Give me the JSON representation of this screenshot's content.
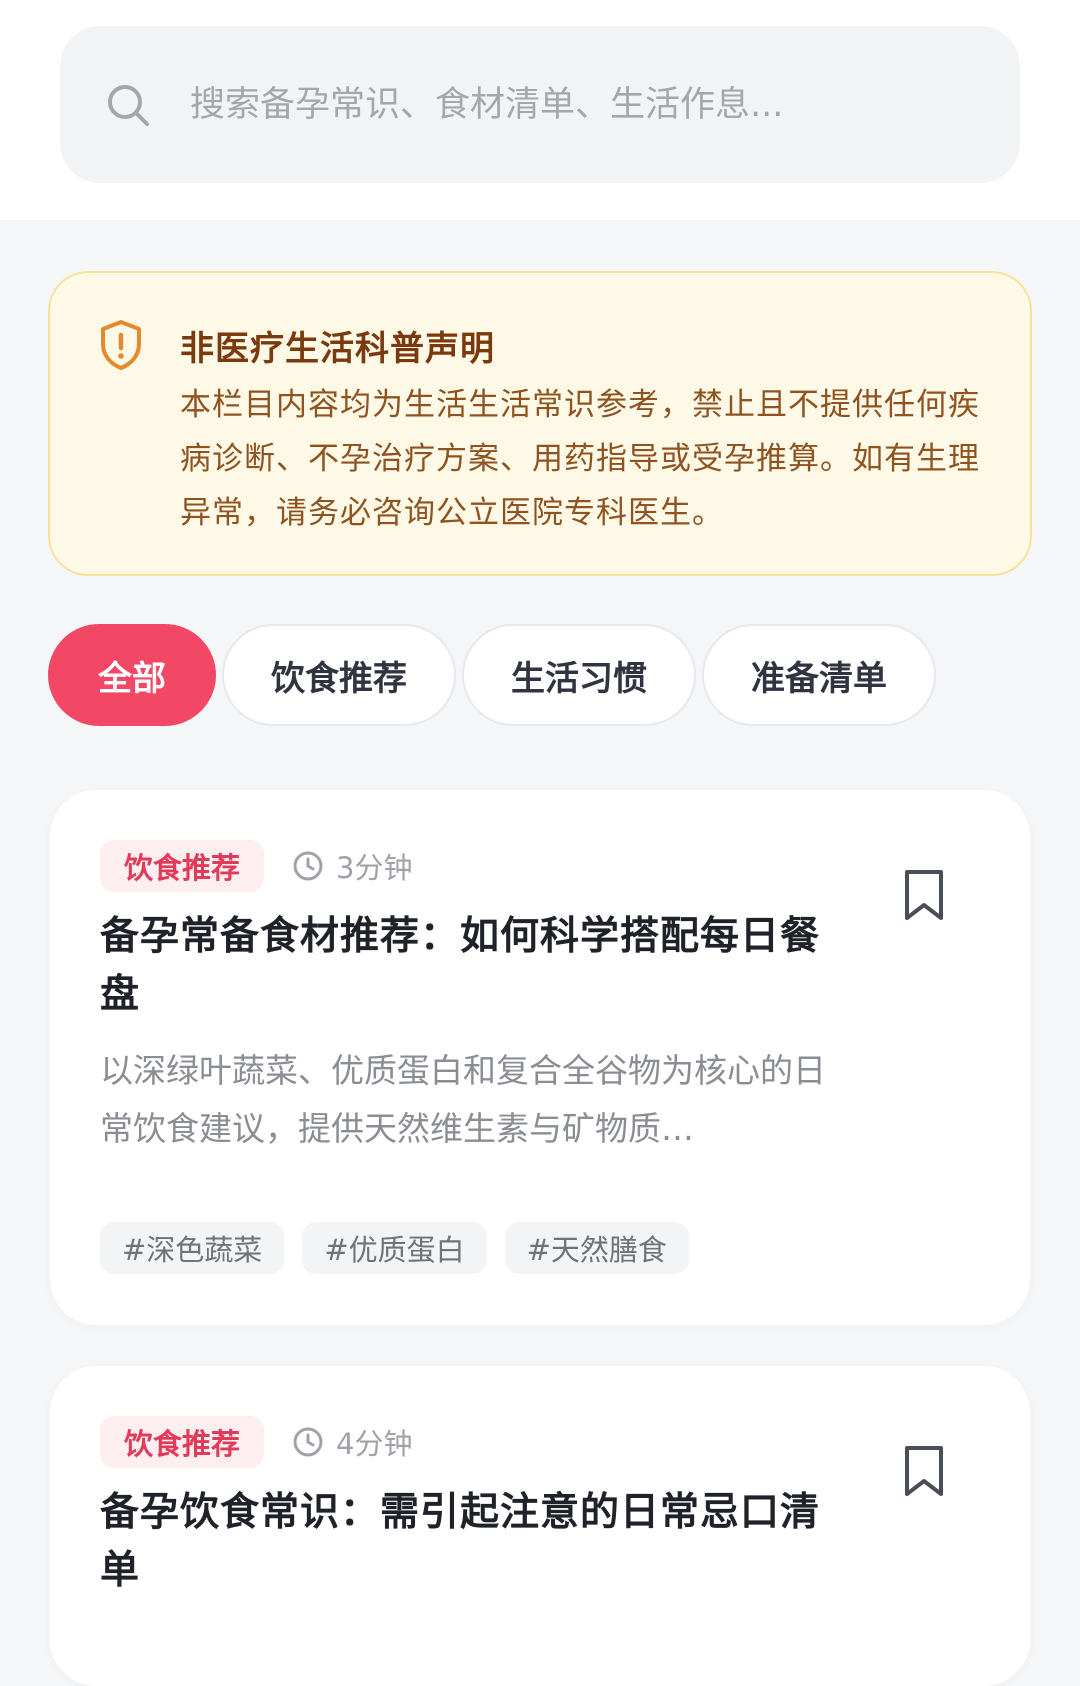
{
  "search": {
    "placeholder": "搜索备孕常识、食材清单、生活作息..."
  },
  "notice": {
    "title": "非医疗生活科普声明",
    "body": "本栏目内容均为生活生活常识参考，禁止且不提供任何疾病诊断、不孕治疗方案、用药指导或受孕推算。如有生理异常，请务必咨询公立医院专科医生。"
  },
  "filters": [
    {
      "label": "全部",
      "active": true
    },
    {
      "label": "饮食推荐",
      "active": false
    },
    {
      "label": "生活习惯",
      "active": false
    },
    {
      "label": "准备清单",
      "active": false
    }
  ],
  "articles": [
    {
      "category": "饮食推荐",
      "read_time": "3分钟",
      "title": "备孕常备食材推荐：如何科学搭配每日餐盘",
      "summary": "以深绿叶蔬菜、优质蛋白和复合全谷物为核心的日常饮食建议，提供天然维生素与矿物质…",
      "tags": [
        "#深色蔬菜",
        "#优质蛋白",
        "#天然膳食"
      ]
    },
    {
      "category": "饮食推荐",
      "read_time": "4分钟",
      "title": "备孕饮食常识：需引起注意的日常忌口清单"
    }
  ],
  "colors": {
    "accent": "#f24866",
    "notice_bg": "#fef9e6",
    "notice_border": "#f6e39a",
    "notice_title": "#7a3a0e",
    "badge_text": "#e23a59"
  },
  "icons": {
    "search": "search-icon",
    "notice": "shield-alert-icon",
    "time": "clock-icon",
    "save": "bookmark-icon"
  }
}
